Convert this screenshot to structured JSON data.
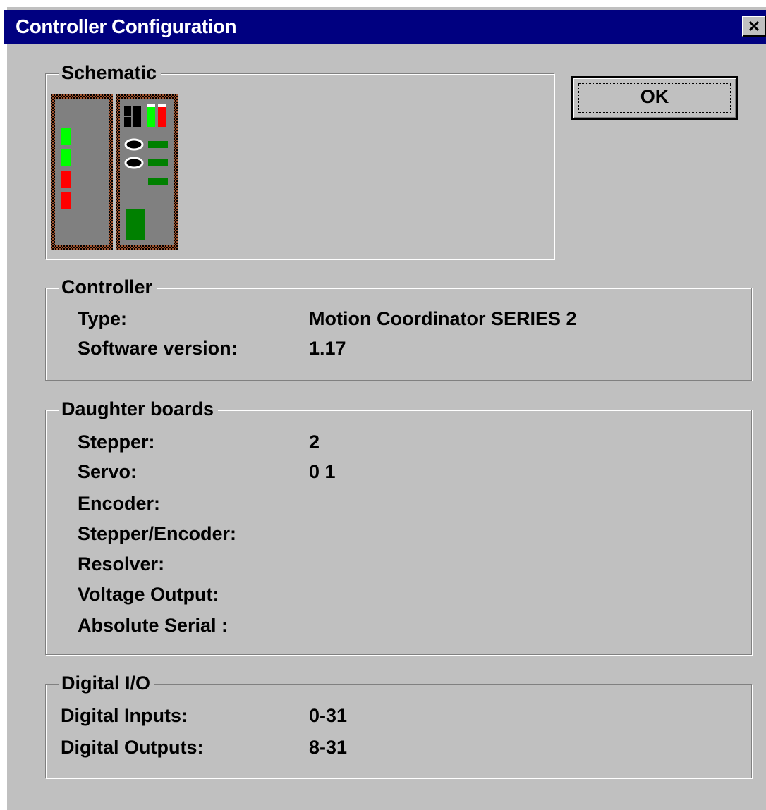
{
  "window": {
    "title": "Controller Configuration",
    "close_icon": "close-x-icon"
  },
  "buttons": {
    "ok_label": "OK"
  },
  "schematic": {
    "title": "Schematic",
    "image_icon": "controller-schematic-icon",
    "colors": {
      "frame": "#8b4513",
      "panel": "#808080",
      "led_green": "#00ff00",
      "led_red": "#ff0000",
      "dark_green": "#008000"
    }
  },
  "controller": {
    "title": "Controller",
    "rows": [
      {
        "label": "Type:",
        "value": "Motion Coordinator SERIES 2"
      },
      {
        "label": "Software version:",
        "value": "1.17"
      }
    ]
  },
  "daughter_boards": {
    "title": "Daughter boards",
    "rows": [
      {
        "label": "Stepper:",
        "value": "2"
      },
      {
        "label": "Servo:",
        "value": "0 1"
      },
      {
        "label": "Encoder:",
        "value": ""
      },
      {
        "label": "Stepper/Encoder:",
        "value": ""
      },
      {
        "label": "Resolver:",
        "value": ""
      },
      {
        "label": "Voltage Output:",
        "value": ""
      },
      {
        "label": "Absolute Serial :",
        "value": ""
      }
    ]
  },
  "digital_io": {
    "title": "Digital I/O",
    "rows": [
      {
        "label": "Digital Inputs:",
        "value": "0-31"
      },
      {
        "label": "Digital Outputs:",
        "value": "8-31"
      }
    ]
  }
}
